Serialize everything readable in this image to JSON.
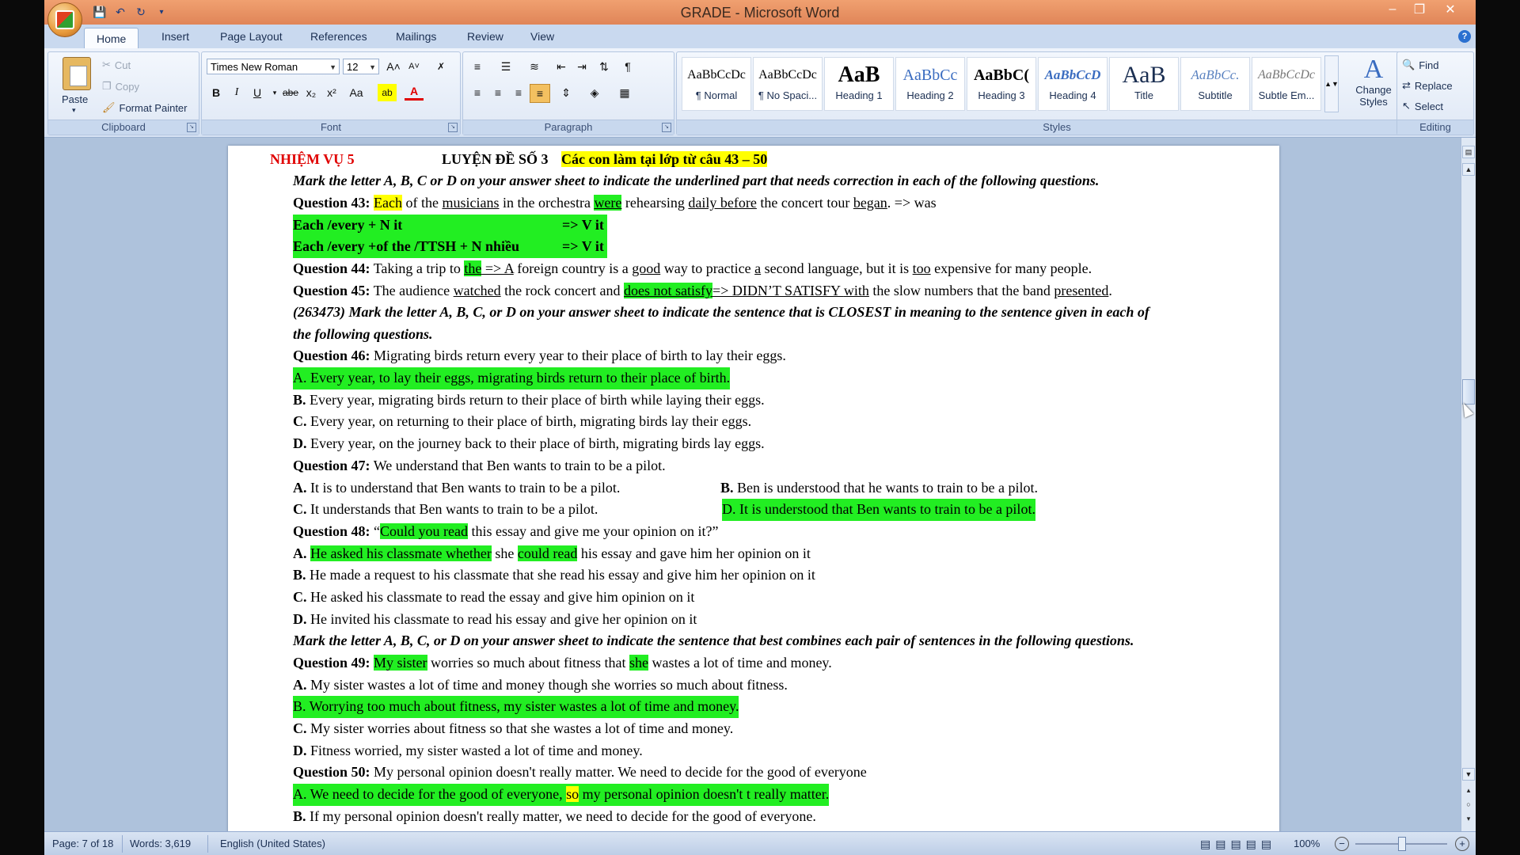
{
  "window": {
    "title": "GRADE - Microsoft Word",
    "minimize": "–",
    "restore": "❐",
    "close": "✕"
  },
  "qat": {
    "save_icon": "save-icon",
    "undo_icon": "undo-icon",
    "redo_icon": "redo-icon"
  },
  "tabs": [
    "Home",
    "Insert",
    "Page Layout",
    "References",
    "Mailings",
    "Review",
    "View"
  ],
  "clipboard": {
    "paste": "Paste",
    "cut": "Cut",
    "copy": "Copy",
    "format_painter": "Format Painter",
    "label": "Clipboard"
  },
  "font": {
    "name": "Times New Roman",
    "size": "12",
    "label": "Font",
    "grow": "A˄",
    "shrink": "A˅",
    "bold": "B",
    "italic": "I",
    "underline": "U",
    "strike": "abe",
    "subscript": "x₂",
    "superscript": "x²",
    "case": "Aa",
    "color": "A",
    "highlight": "ab"
  },
  "paragraph": {
    "label": "Paragraph",
    "pilcrow": "¶"
  },
  "styles": {
    "label": "Styles",
    "items": [
      {
        "sample": "AaBbCcDc",
        "name": "¶ Normal"
      },
      {
        "sample": "AaBbCcDc",
        "name": "¶ No Spaci..."
      },
      {
        "sample": "AaB",
        "name": "Heading 1"
      },
      {
        "sample": "AaBbCc",
        "name": "Heading 2"
      },
      {
        "sample": "AaBbC(",
        "name": "Heading 3"
      },
      {
        "sample": "AaBbCcD",
        "name": "Heading 4"
      },
      {
        "sample": "AaB",
        "name": "Title"
      },
      {
        "sample": "AaBbCc.",
        "name": "Subtitle"
      },
      {
        "sample": "AaBbCcDc",
        "name": "Subtle Em..."
      }
    ],
    "change_line1": "Change",
    "change_line2": "Styles"
  },
  "editing": {
    "label": "Editing",
    "find": "Find",
    "replace": "Replace",
    "select": "Select"
  },
  "doc": {
    "header_red": "NHIỆM VỤ 5",
    "header_title": "LUYỆN ĐỀ SỐ 3",
    "header_hl": "Các con làm tại lớp từ câu 43 – 50",
    "instr1": "Mark the letter A, B, C or D on your answer sheet to indicate the underlined part that needs correction in each of the following questions.",
    "q43_label": "Question 43:",
    "q43_each": "Each",
    "q43_t1": " of the ",
    "q43_musicians": "musicians",
    "q43_t2": " in the orchestra ",
    "q43_were": "were",
    "q43_t3": " rehearsing  ",
    "q43_daily": "daily before",
    "q43_t4": " the concert tour ",
    "q43_began": "began",
    "q43_t5": ".   => was",
    "rule1a": "Each /every + N it",
    "rule1b": "=> V it",
    "rule2a": "Each /every +of the /TTSH  +  N nhiều",
    "rule2b": "=> V it",
    "q44_label": "Question 44:",
    "q44_t1": " Taking a trip to ",
    "q44_the": "the",
    "q44_arrow": " => A",
    "q44_t2": " foreign country is a ",
    "q44_good": "good",
    "q44_t3": " way to practice ",
    "q44_a": "a",
    "q44_t4": " second language, but it is ",
    "q44_too": "too",
    "q44_t5": " expensive for many people.",
    "q45_label": "Question 45:",
    "q45_t1": " The audience ",
    "q45_watched": "watched",
    "q45_t2": " the rock concert and ",
    "q45_dns": "does not satisfy",
    "q45_fix": "=> DIDN’T SATISFY  ",
    "q45_t3": " ",
    "q45_with": "with",
    "q45_t4": " the slow numbers that the band ",
    "q45_presented": "presented",
    "q45_t5": ".",
    "instr2a": " (263473) Mark the letter A, B, C, or D on your answer sheet to indicate the sentence that is CLOSEST in meaning to the sentence given in each of",
    "instr2b": "the following questions.",
    "q46_label": "Question 46:",
    "q46_text": " Migrating birds return every year to their place of birth to lay their eggs.",
    "q46_a": "A. Every year, to lay their eggs, migrating birds return to their place of birth.",
    "q46_b_l": "B.",
    "q46_b": " Every year, migrating birds return to their place of birth while laying their eggs.",
    "q46_c_l": "C.",
    "q46_c": " Every year, on returning to their place of birth, migrating birds lay their eggs.",
    "q46_d_l": "D.",
    "q46_d": " Every year, on the journey back to their place of birth, migrating birds lay eggs.",
    "q47_label": "Question 47:",
    "q47_text": " We understand that Ben wants to train to be a pilot.",
    "q47_a_l": "A.",
    "q47_a": " It is to understand that Ben wants to train to be a pilot.",
    "q47_b_l": "B.",
    "q47_b": " Ben is understood that he wants to train to be a pilot.",
    "q47_c_l": "C.",
    "q47_c": " It understands that Ben wants to train to be a pilot.",
    "q47_d": "D. It is understood that Ben wants to train to be a pilot.",
    "q48_label": "Question 48:",
    "q48_q": " “",
    "q48_hl": "Could you read",
    "q48_text": " this essay and give me your opinion on it?”",
    "q48_a_l": "A.",
    "q48_a_hl1": "He asked his classmate whether",
    "q48_a_t1": " she ",
    "q48_a_hl2": "could read",
    "q48_a_t2": " his essay and gave him her opinion on it",
    "q48_b_l": "B.",
    "q48_b": " He made a request to his classmate that she read his essay and give him her opinion on it",
    "q48_c_l": "C.",
    "q48_c": " He asked his classmate to read the essay and give him opinion on it",
    "q48_d_l": "D.",
    "q48_d": " He invited his classmate to read his essay and give her opinion on it",
    "instr3": "Mark the letter A, B, C, or D on your answer sheet to indicate the sentence that best combines each pair of sentences in the following questions.",
    "q49_label": "Question 49:",
    "q49_hl1": "My sister",
    "q49_t1": " worries so much about fitness that ",
    "q49_hl2": "she",
    "q49_t2": " wastes a lot of time and money.",
    "q49_a_l": "A.",
    "q49_a": " My sister wastes a lot of time and money though she worries so much about fitness.",
    "q49_b": "B. Worrying too much about fitness, my sister wastes a lot of time and money.",
    "q49_c_l": "C.",
    "q49_c": " My sister worries about fitness so that she wastes a lot of time and money.",
    "q49_d_l": "D.",
    "q49_d": " Fitness worried, my sister wasted a lot of time and money.",
    "q50_label": "Question 50:",
    "q50_text": " My personal opinion doesn't really matter. We need to decide for the good of everyone",
    "q50_a1": "A. We need to decide for the good of everyone, ",
    "q50_so": "so",
    "q50_a2": " my personal opinion doesn't t really matter.",
    "q50_b_l": "B.",
    "q50_b": " If my personal opinion doesn't really matter, we need to decide for the good of everyone."
  },
  "status": {
    "page": "Page: 7 of 18",
    "words": "Words: 3,619",
    "language": "English (United States)",
    "zoom": "100%",
    "zoom_out": "−",
    "zoom_in": "+"
  },
  "colors": {
    "highlight_green": "#22ee22",
    "highlight_yellow": "#ffff00",
    "heading_red": "#e00000"
  }
}
